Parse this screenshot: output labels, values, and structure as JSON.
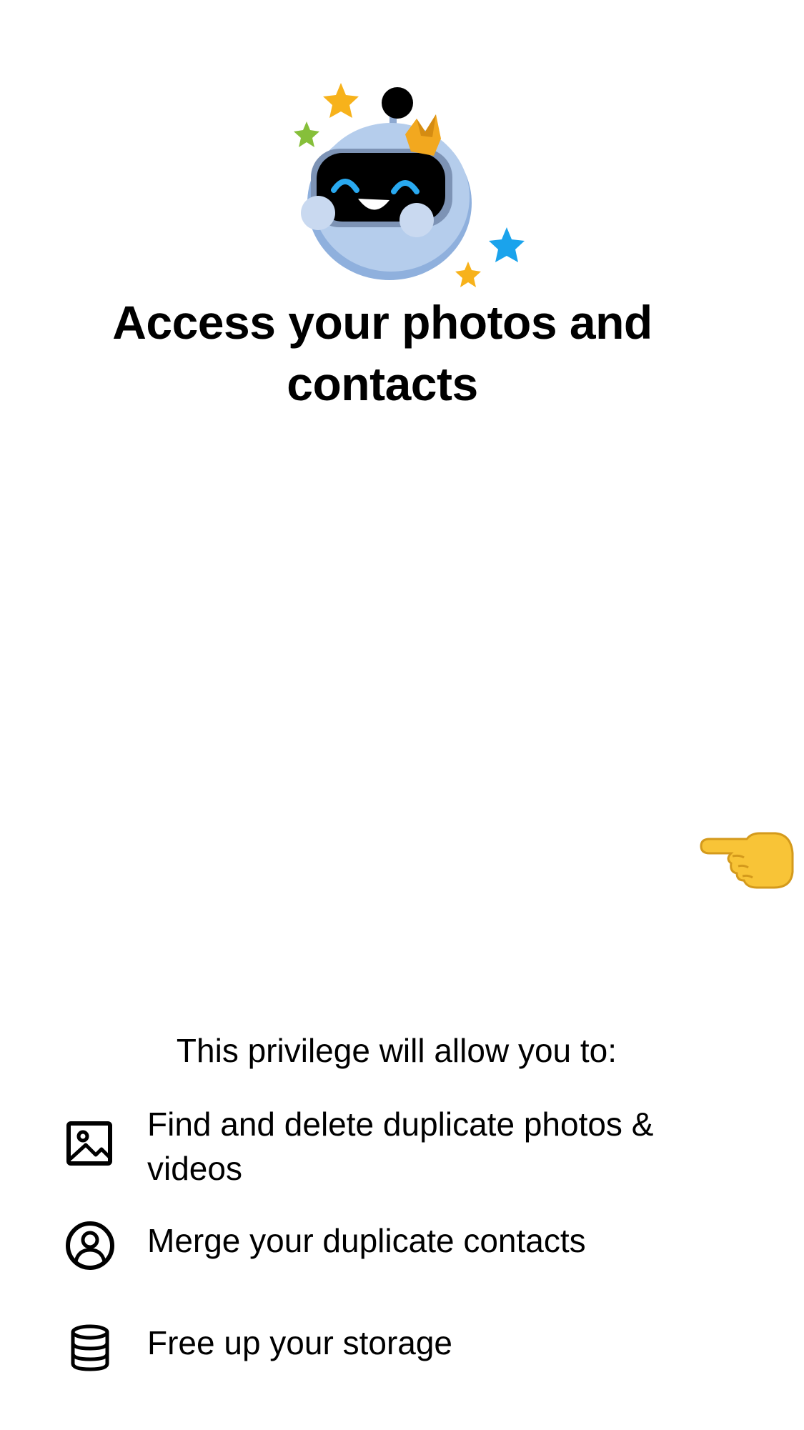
{
  "header": {
    "title": "Access your photos and contacts"
  },
  "illustration": {
    "mascot_icon": "robot-mascot-icon",
    "pointer_icon": "pointing-left-hand-icon"
  },
  "permissions": {
    "intro": "This privilege will allow you to:",
    "items": [
      {
        "icon": "photo-icon",
        "label": "Find and delete duplicate photos & videos"
      },
      {
        "icon": "person-circle-icon",
        "label": "Merge your duplicate contacts"
      },
      {
        "icon": "database-icon",
        "label": "Free up your storage"
      }
    ]
  },
  "colors": {
    "background": "#ffffff",
    "text": "#000000",
    "robot_body": "#b5cdec",
    "robot_accent": "#29a9f0",
    "star_yellow": "#f7b21b",
    "star_green": "#86bf3a",
    "star_blue": "#1aa3ec",
    "crown": "#f2a81f",
    "hand": "#f8c437"
  }
}
